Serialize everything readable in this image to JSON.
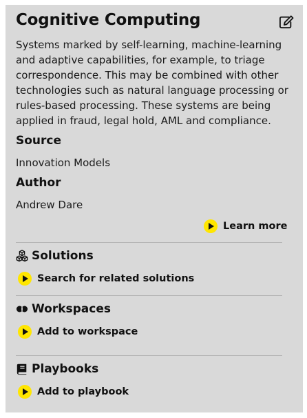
{
  "card": {
    "title": "Cognitive Computing",
    "description": "Systems marked by self-learning, machine-learning and adaptive capabilities, for example, to triage correspondence. This may be combined with other technologies such as natural language processing or rules-based processing. These systems are being applied in fraud, legal hold, AML and compliance.",
    "source_label": "Source",
    "source_value": "Innovation Models",
    "author_label": "Author",
    "author_value": "Andrew Dare",
    "learn_more": "Learn more"
  },
  "sections": {
    "solutions": {
      "title": "Solutions",
      "icon": "cubes-icon",
      "action": "Search for related solutions"
    },
    "workspaces": {
      "title": "Workspaces",
      "icon": "link-icon",
      "action": "Add to workspace"
    },
    "playbooks": {
      "title": "Playbooks",
      "icon": "book-icon",
      "action": "Add to playbook"
    }
  },
  "colors": {
    "panel_bg": "#d9d9d9",
    "accent": "#ffe600",
    "text": "#111111"
  }
}
